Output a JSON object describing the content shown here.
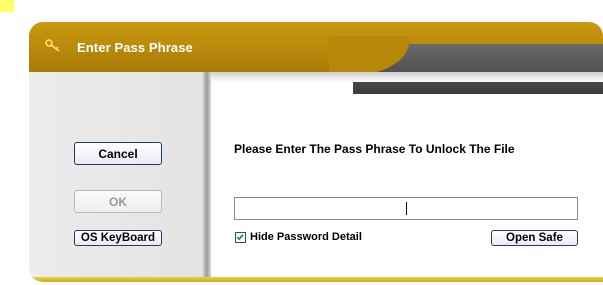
{
  "dialog": {
    "title": "Enter Pass Phrase",
    "prompt": "Please Enter The Pass Phrase To Unlock The File",
    "pass_input": {
      "value": "",
      "placeholder": ""
    },
    "hide_password": {
      "label": "Hide Password Detail",
      "checked": true
    }
  },
  "buttons": {
    "cancel": "Cancel",
    "ok": "OK",
    "os_keyboard": "OS KeyBoard",
    "open_safe": "Open Safe"
  },
  "icons": {
    "title_icon": "key-icon",
    "check_icon": "checkmark-icon"
  },
  "colors": {
    "title_bar": "#b7870a",
    "accent_bottom": "#d8c228",
    "button_border": "#1f3b70"
  }
}
